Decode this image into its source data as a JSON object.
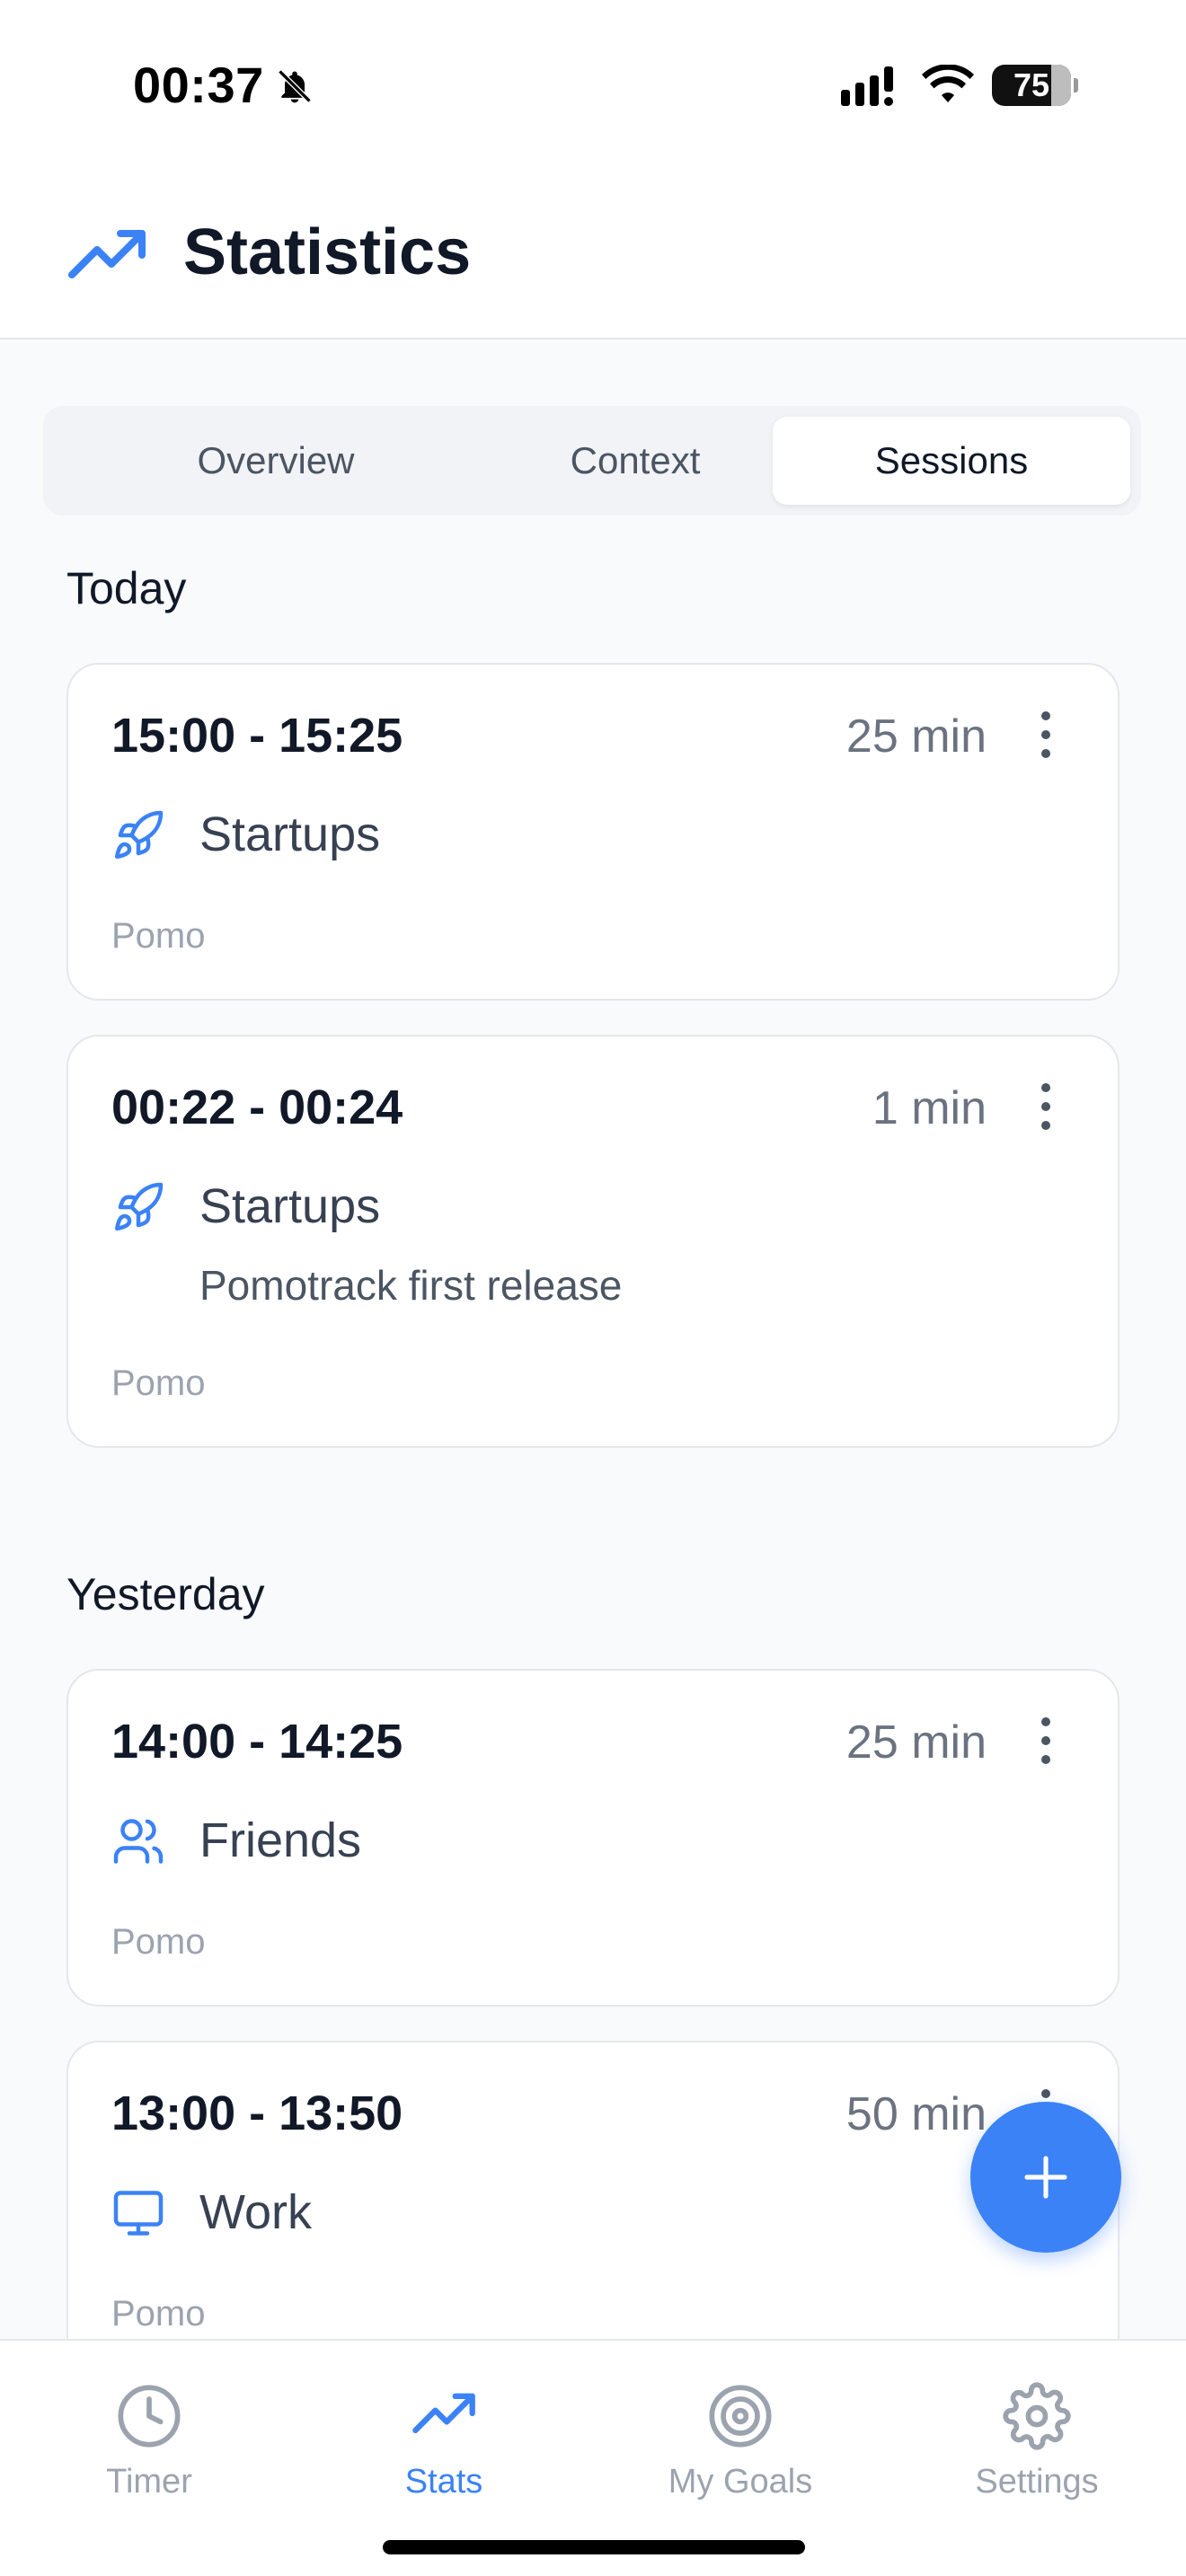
{
  "status_bar": {
    "time": "00:37",
    "battery": "75"
  },
  "header": {
    "title": "Statistics",
    "icon": "trending-up-icon"
  },
  "tabs": [
    {
      "label": "Overview",
      "active": false
    },
    {
      "label": "Context",
      "active": false
    },
    {
      "label": "Sessions",
      "active": true
    }
  ],
  "sections": [
    {
      "label": "Today",
      "sessions": [
        {
          "time": "15:00 - 15:25",
          "duration": "25 min",
          "category": "Startups",
          "category_icon": "rocket-icon",
          "note": "",
          "type": "Pomo"
        },
        {
          "time": "00:22 - 00:24",
          "duration": "1 min",
          "category": "Startups",
          "category_icon": "rocket-icon",
          "note": "Pomotrack first release",
          "type": "Pomo"
        }
      ]
    },
    {
      "label": "Yesterday",
      "sessions": [
        {
          "time": "14:00 - 14:25",
          "duration": "25 min",
          "category": "Friends",
          "category_icon": "users-icon",
          "note": "",
          "type": "Pomo"
        },
        {
          "time": "13:00 - 13:50",
          "duration": "50 min",
          "category": "Work",
          "category_icon": "monitor-icon",
          "note": "",
          "type": "Pomo"
        }
      ]
    }
  ],
  "bottom_nav": [
    {
      "label": "Timer",
      "icon": "clock-icon",
      "active": false
    },
    {
      "label": "Stats",
      "icon": "trending-up-icon",
      "active": true
    },
    {
      "label": "My Goals",
      "icon": "target-icon",
      "active": false
    },
    {
      "label": "Settings",
      "icon": "gear-icon",
      "active": false
    }
  ],
  "colors": {
    "accent": "#3b82f6",
    "text": "#111827",
    "muted": "#9ca3af",
    "background": "#f8fafc"
  }
}
